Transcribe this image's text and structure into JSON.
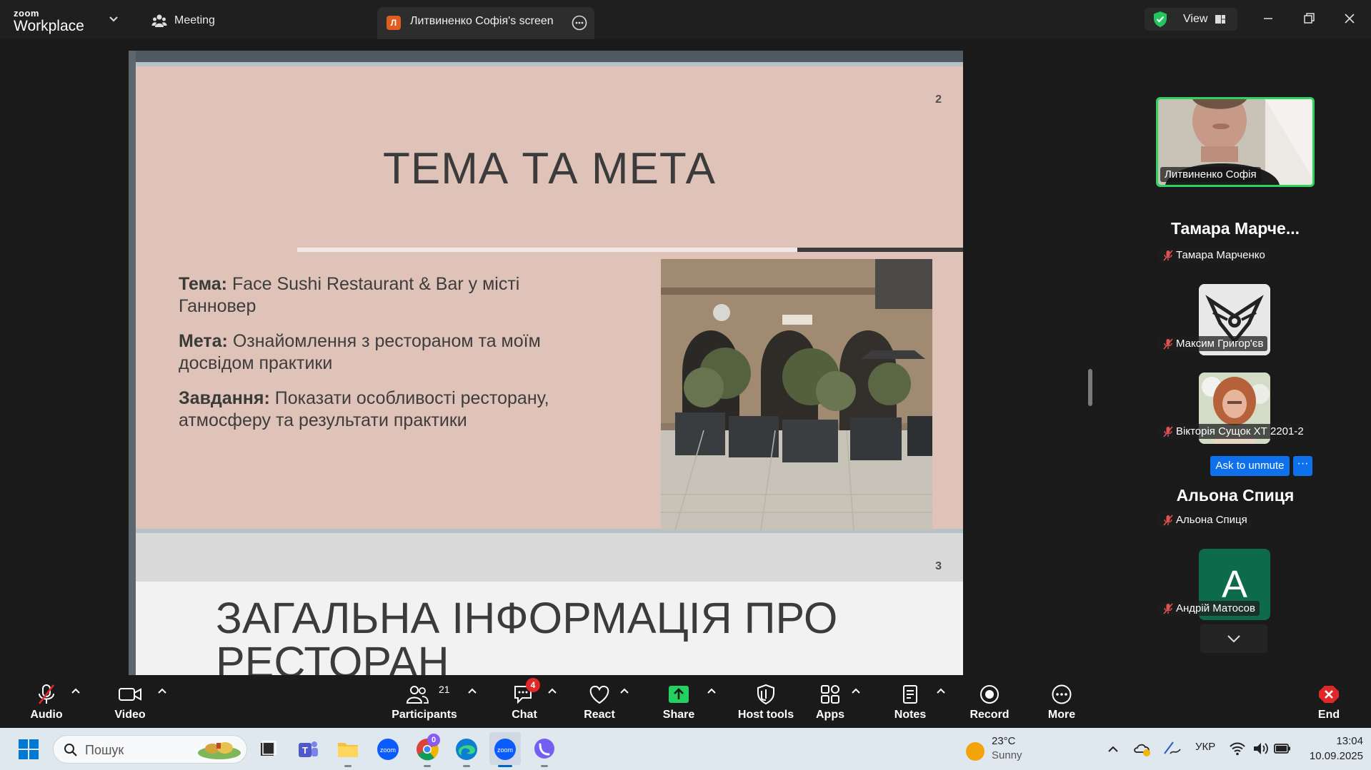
{
  "app": {
    "brand_top": "zoom",
    "brand_bottom": "Workplace"
  },
  "tabs": {
    "meeting_label": "Meeting",
    "screen_avatar": "Л",
    "screen_label": "Литвиненко Софія's screen"
  },
  "view_button": {
    "label": "View"
  },
  "slide2": {
    "number": "2",
    "title": "ТЕМА ТА МЕТА",
    "items": [
      {
        "key": "Тема:",
        "text": " Face Sushi Restaurant & Bar у місті Ганновер"
      },
      {
        "key": "Мета:",
        "text": " Ознайомлення з рестораном та моїм досвідом практики"
      },
      {
        "key": "Завдання:",
        "text": " Показати особливості ресторану, атмосферу та результати практики"
      }
    ]
  },
  "slide3": {
    "number": "3",
    "title": "ЗАГАЛЬНА ІНФОРМАЦІЯ ПРО РЕСТОРАН"
  },
  "participants_panel": {
    "tiles": [
      {
        "name": "Литвиненко Софія"
      },
      {
        "big_name": "Тамара  Марче...",
        "name": "Тамара Марченко"
      },
      {
        "name": "Максим Григор'єв"
      },
      {
        "name": "Вікторія Сущок ХТ 2201-2"
      },
      {
        "big_name": "Альона Спиця",
        "name": "Альона Спиця"
      },
      {
        "avatar_letter": "A",
        "name": "Андрій Матосов"
      }
    ],
    "ask_unmute_label": "Ask to unmute",
    "more_label": "···"
  },
  "toolbar": {
    "audio": "Audio",
    "video": "Video",
    "participants": "Participants",
    "participants_count": "21",
    "chat": "Chat",
    "chat_badge": "4",
    "react": "React",
    "share": "Share",
    "host_tools": "Host tools",
    "apps": "Apps",
    "notes": "Notes",
    "record": "Record",
    "more": "More",
    "end": "End"
  },
  "taskbar": {
    "search_placeholder": "Пошук",
    "chrome_badge": "0",
    "weather_temp": "23°C",
    "weather_desc": "Sunny",
    "language": "УКР",
    "time": "13:04",
    "date": "10.09.2025"
  },
  "colors": {
    "active_speaker": "#2ed35f",
    "zoom_blue": "#0e71eb",
    "share_green": "#23d160",
    "end_red": "#e02828",
    "slide_background": "#dfc2b8"
  }
}
